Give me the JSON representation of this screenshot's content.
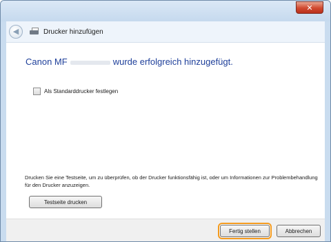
{
  "window": {
    "title": "Drucker hinzufügen",
    "close_glyph": "✕",
    "back_glyph": "◀"
  },
  "content": {
    "heading_prefix": "Canon MF",
    "heading_suffix": "wurde erfolgreich hinzugefügt.",
    "default_printer_checkbox": {
      "label": "Als Standarddrucker festlegen",
      "checked": false
    },
    "info_text": "Drucken Sie eine Testseite, um zu überprüfen, ob der Drucker funktionsfähig ist, oder um Informationen zur Problembehandlung für den Drucker anzuzeigen.",
    "test_page_button": "Testseite drucken"
  },
  "footer": {
    "finish_button": "Fertig stellen",
    "cancel_button": "Abbrechen"
  },
  "colors": {
    "heading": "#1e3f9a",
    "highlight": "#f39a1e",
    "close": "#d0492f"
  },
  "icons": [
    "back-arrow-icon",
    "printer-icon",
    "close-icon"
  ]
}
